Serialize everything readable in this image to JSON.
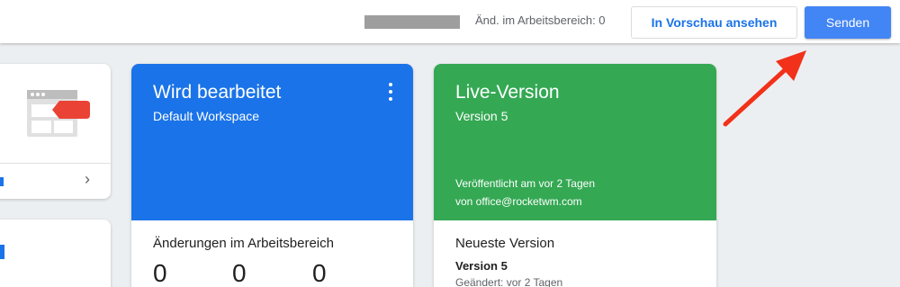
{
  "topbar": {
    "workspace_changes": "Änd. im Arbeitsbereich: 0",
    "preview_label": "In Vorschau ansehen",
    "submit_label": "Senden"
  },
  "editing_card": {
    "title": "Wird bearbeitet",
    "subtitle": "Default Workspace",
    "section_title": "Änderungen im Arbeitsbereich",
    "counts": [
      "0",
      "0",
      "0"
    ]
  },
  "live_card": {
    "title": "Live-Version",
    "subtitle": "Version 5",
    "published": "Veröffentlicht am vor 2 Tagen",
    "published_by": "von office@rocketwm.com",
    "section_title": "Neueste Version",
    "version_label": "Version 5",
    "changed": "Geändert: vor 2 Tagen"
  },
  "colors": {
    "editing_header": "#1a73e8",
    "live_header": "#34a853",
    "submit_button": "#4285f4",
    "annotation_arrow": "#f2311a"
  }
}
